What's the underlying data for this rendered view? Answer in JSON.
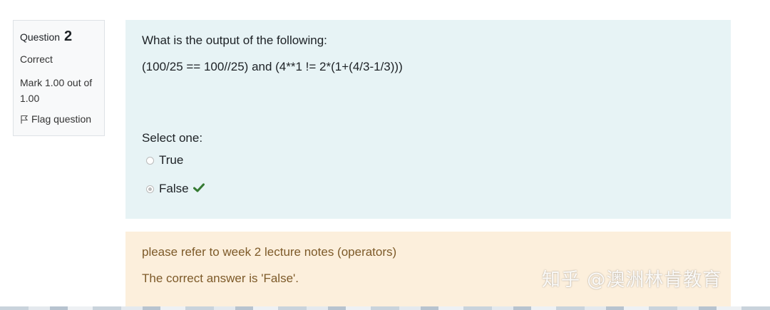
{
  "info": {
    "question_label": "Question",
    "question_number": "2",
    "state": "Correct",
    "grade": "Mark 1.00 out of 1.00",
    "flag_label": "Flag question"
  },
  "question": {
    "text_line1": "What is the output of the following:",
    "text_line2": "(100/25 == 100//25) and (4**1 != 2*(1+(4/3-1/3)))",
    "prompt": "Select one:",
    "options": [
      {
        "label": "True",
        "selected": false
      },
      {
        "label": "False",
        "selected": true,
        "correct": true
      }
    ]
  },
  "outcome": {
    "feedback": "please refer to week 2 lecture notes (operators)",
    "right_answer": "The correct answer is 'False'."
  },
  "watermark": "知乎 @澳洲林肯教育",
  "colors": {
    "formulation_bg": "#e7f3f5",
    "outcome_bg": "#fcefdc",
    "outcome_text": "#7d5a29",
    "check_green": "#357a32"
  }
}
